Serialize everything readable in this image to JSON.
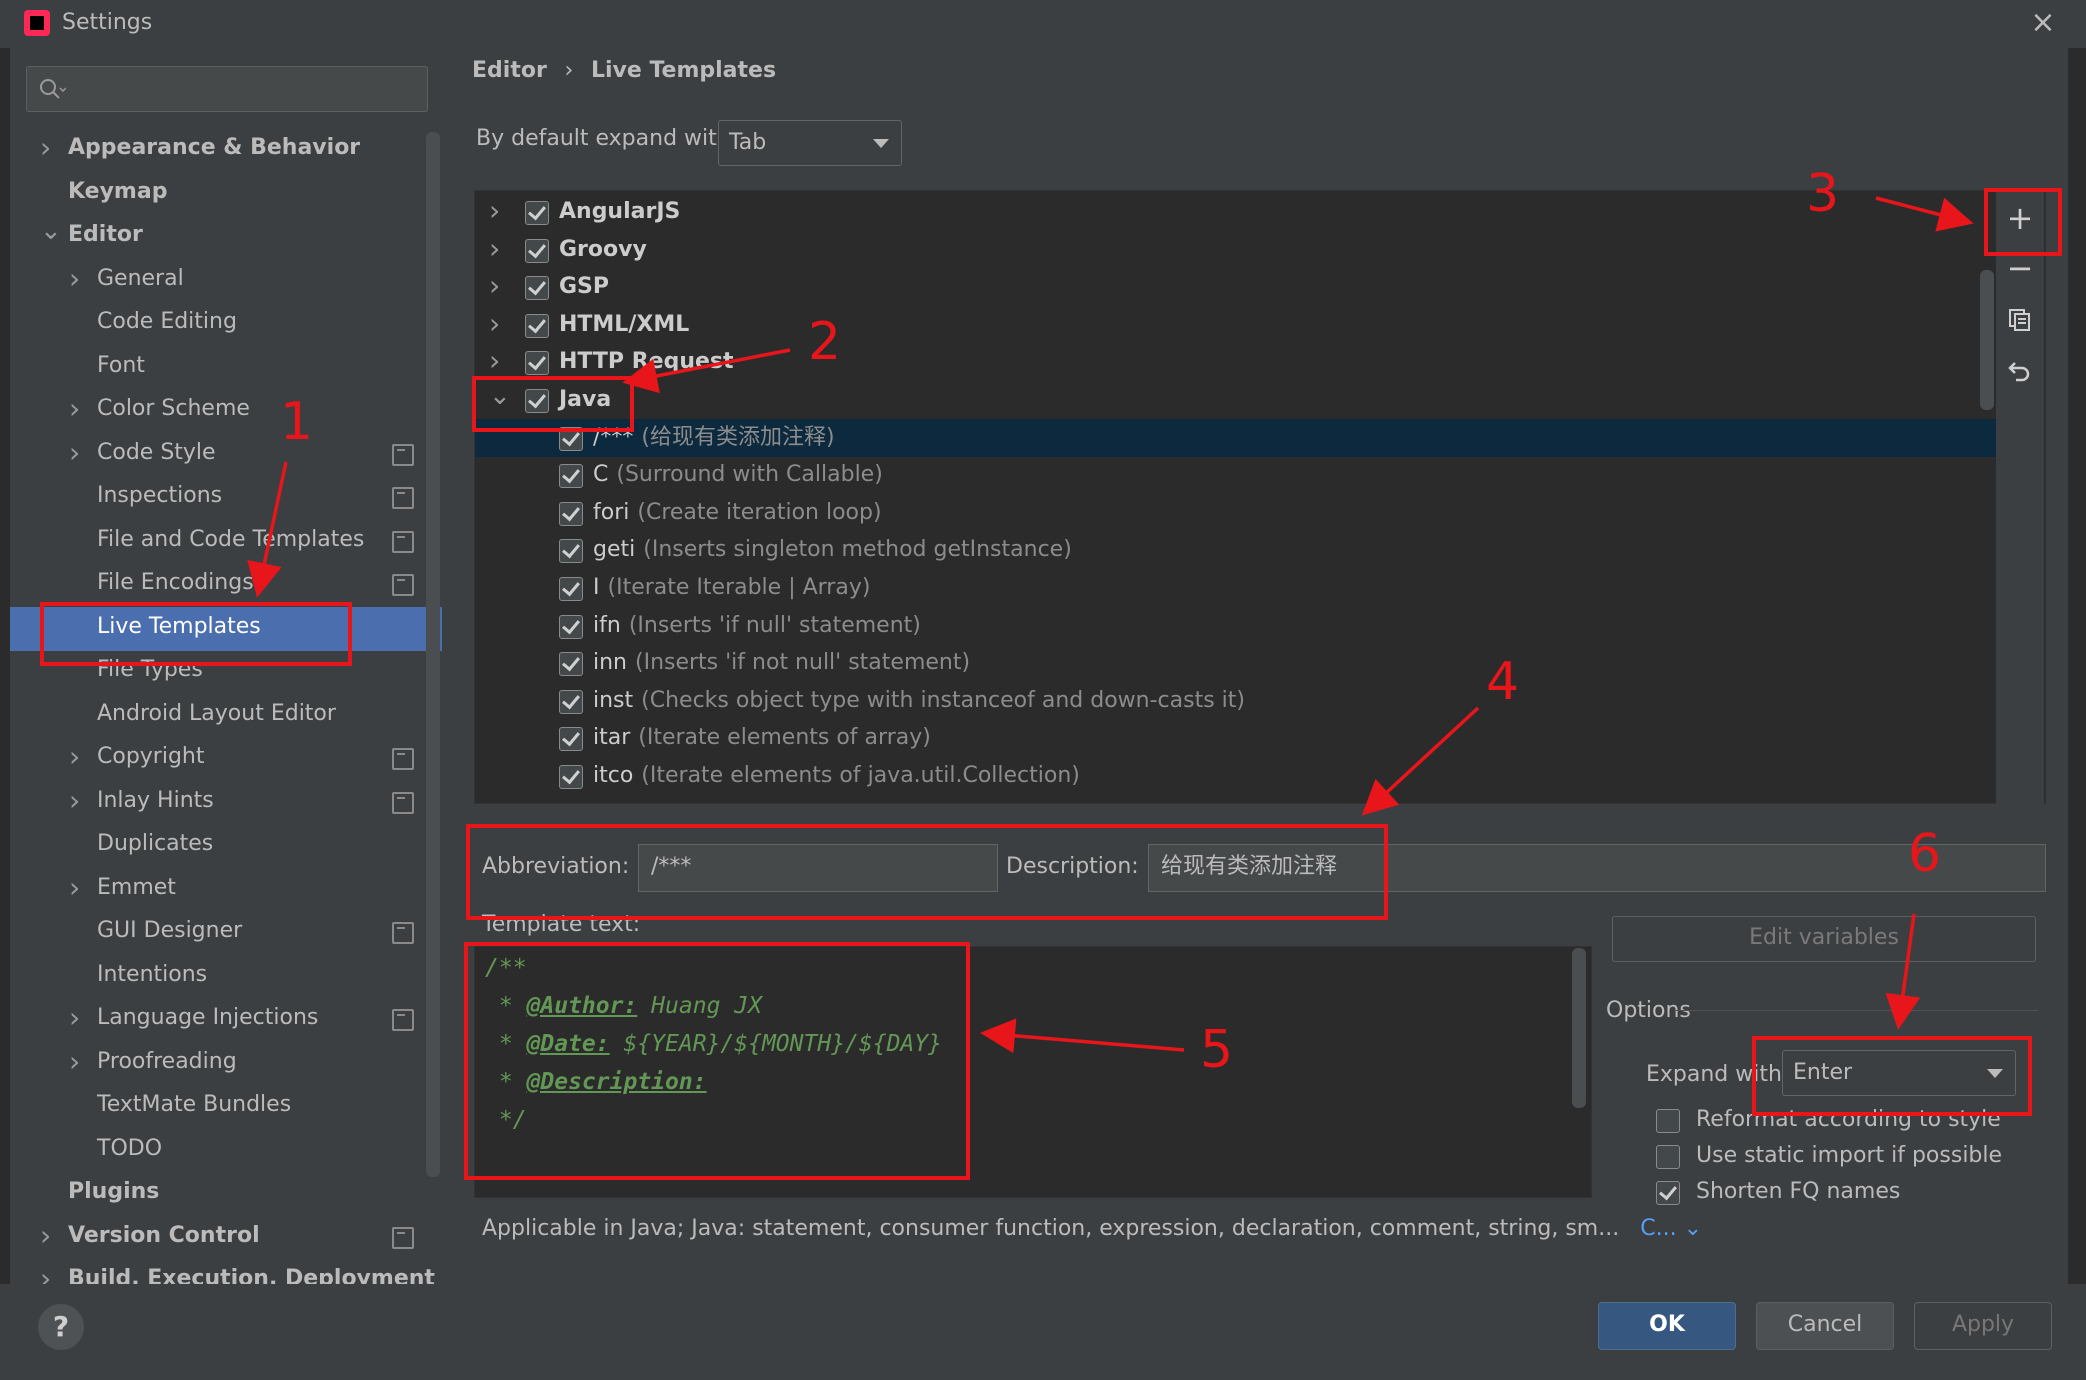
{
  "window": {
    "title": "Settings",
    "close_icon": "×"
  },
  "sidebar": {
    "search_placeholder": "",
    "items": [
      {
        "label": "Appearance & Behavior",
        "bold": true
      },
      {
        "label": "Keymap",
        "bold": true
      },
      {
        "label": "Editor",
        "bold": true
      },
      {
        "label": "General"
      },
      {
        "label": "Code Editing"
      },
      {
        "label": "Font"
      },
      {
        "label": "Color Scheme"
      },
      {
        "label": "Code Style"
      },
      {
        "label": "Inspections"
      },
      {
        "label": "File and Code Templates"
      },
      {
        "label": "File Encodings"
      },
      {
        "label": "Live Templates"
      },
      {
        "label": "File Types"
      },
      {
        "label": "Android Layout Editor"
      },
      {
        "label": "Copyright"
      },
      {
        "label": "Inlay Hints"
      },
      {
        "label": "Duplicates"
      },
      {
        "label": "Emmet"
      },
      {
        "label": "GUI Designer"
      },
      {
        "label": "Intentions"
      },
      {
        "label": "Language Injections"
      },
      {
        "label": "Proofreading"
      },
      {
        "label": "TextMate Bundles"
      },
      {
        "label": "TODO"
      },
      {
        "label": "Plugins",
        "bold": true
      },
      {
        "label": "Version Control",
        "bold": true
      },
      {
        "label": "Build, Execution, Deployment",
        "bold": true
      }
    ]
  },
  "breadcrumb": {
    "parent": "Editor",
    "sep": "›",
    "current": "Live Templates"
  },
  "expand_default": {
    "label": "By default expand with",
    "value": "Tab"
  },
  "template_list": {
    "groups": [
      {
        "name": "AngularJS",
        "checked": true
      },
      {
        "name": "Groovy",
        "checked": true
      },
      {
        "name": "GSP",
        "checked": true
      },
      {
        "name": "HTML/XML",
        "checked": true
      },
      {
        "name": "HTTP Request",
        "checked": true
      },
      {
        "name": "Java",
        "checked": true,
        "expanded": true
      }
    ],
    "templates": [
      {
        "abbr": "/***",
        "desc": "(给现有类添加注释)",
        "checked": true,
        "selected": true
      },
      {
        "abbr": "C",
        "desc": "(Surround with Callable)",
        "checked": true
      },
      {
        "abbr": "fori",
        "desc": "(Create iteration loop)",
        "checked": true
      },
      {
        "abbr": "geti",
        "desc": "(Inserts singleton method getInstance)",
        "checked": true
      },
      {
        "abbr": "I",
        "desc": "(Iterate Iterable | Array)",
        "checked": true
      },
      {
        "abbr": "ifn",
        "desc": "(Inserts 'if null' statement)",
        "checked": true
      },
      {
        "abbr": "inn",
        "desc": "(Inserts 'if not null' statement)",
        "checked": true
      },
      {
        "abbr": "inst",
        "desc": "(Checks object type with instanceof and down-casts it)",
        "checked": true
      },
      {
        "abbr": "itar",
        "desc": "(Iterate elements of array)",
        "checked": true
      },
      {
        "abbr": "itco",
        "desc": "(Iterate elements of java.util.Collection)",
        "checked": true
      }
    ]
  },
  "toolbar": {
    "add_icon": "+",
    "remove_icon": "−",
    "copy_icon": "copy",
    "revert_icon": "revert"
  },
  "details": {
    "abbreviation_label": "Abbreviation:",
    "abbreviation_value": "/***",
    "description_label": "Description:",
    "description_value": "给现有类添加注释",
    "template_text_label": "Template text:",
    "code_lines": [
      "/**",
      " * ",
      "@Author:",
      " Huang JX",
      " * ",
      "@Date:",
      " ${YEAR}/${MONTH}/${DAY}",
      " * ",
      "@Description:",
      " */"
    ],
    "edit_variables": "Edit variables",
    "options_label": "Options",
    "expand_with_label": "Expand with",
    "expand_with_value": "Enter",
    "reformat": {
      "label": "Reformat according to style",
      "checked": false
    },
    "static_import": {
      "label": "Use static import if possible",
      "checked": false
    },
    "shorten_fq": {
      "label": "Shorten FQ names",
      "checked": true
    },
    "applicable_text": "Applicable in Java; Java: statement, consumer function, expression, declaration, comment, string, sm...",
    "applicable_link": "C..."
  },
  "dialog_buttons": {
    "help": "?",
    "ok": "OK",
    "cancel": "Cancel",
    "apply": "Apply"
  },
  "annotations": {
    "n1": "1",
    "n2": "2",
    "n3": "3",
    "n4": "4",
    "n5": "5",
    "n6": "6",
    "color": "#e8161b"
  }
}
